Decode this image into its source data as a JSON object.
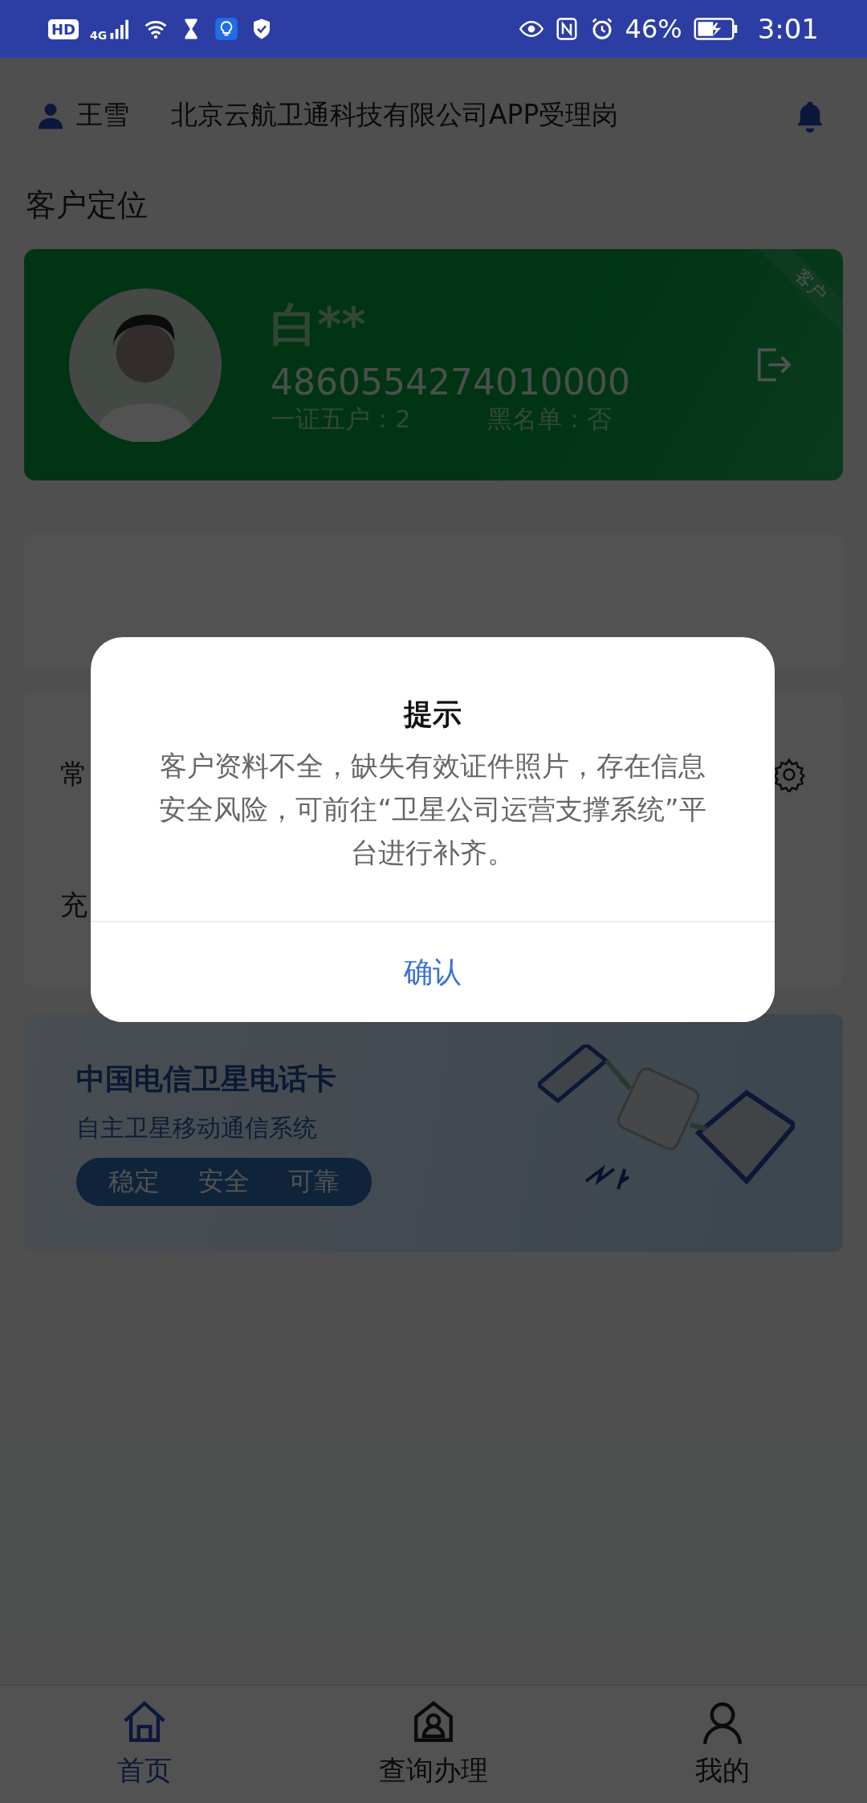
{
  "status_bar": {
    "hd": "HD",
    "network": "4G",
    "battery": "46%",
    "time": "3:01"
  },
  "header": {
    "user": "王雪",
    "org": "北京云航卫通科技有限公司APP受理岗"
  },
  "section_title": "客户定位",
  "customer_card": {
    "tag": "客户",
    "name": "白**",
    "number": "4860554274010000",
    "family_label": "一证五户：2",
    "blacklist_label": "黑名单：否"
  },
  "menu_rows": [
    {
      "label": "常"
    },
    {
      "label": "充"
    }
  ],
  "banner": {
    "title": "中国电信卫星电话卡",
    "subtitle": "自主卫星移动通信系统",
    "features": [
      "稳定",
      "安全",
      "可靠"
    ]
  },
  "dialog": {
    "title": "提示",
    "message": "客户资料不全，缺失有效证件照片，存在信息安全风险，可前往“卫星公司运营支撑系统”平台进行补齐。",
    "button": "确认"
  },
  "nav": [
    {
      "kind": "home",
      "label": "首页",
      "selected": true
    },
    {
      "kind": "query",
      "label": "查询办理",
      "selected": false
    },
    {
      "kind": "me",
      "label": "我的",
      "selected": false
    }
  ]
}
